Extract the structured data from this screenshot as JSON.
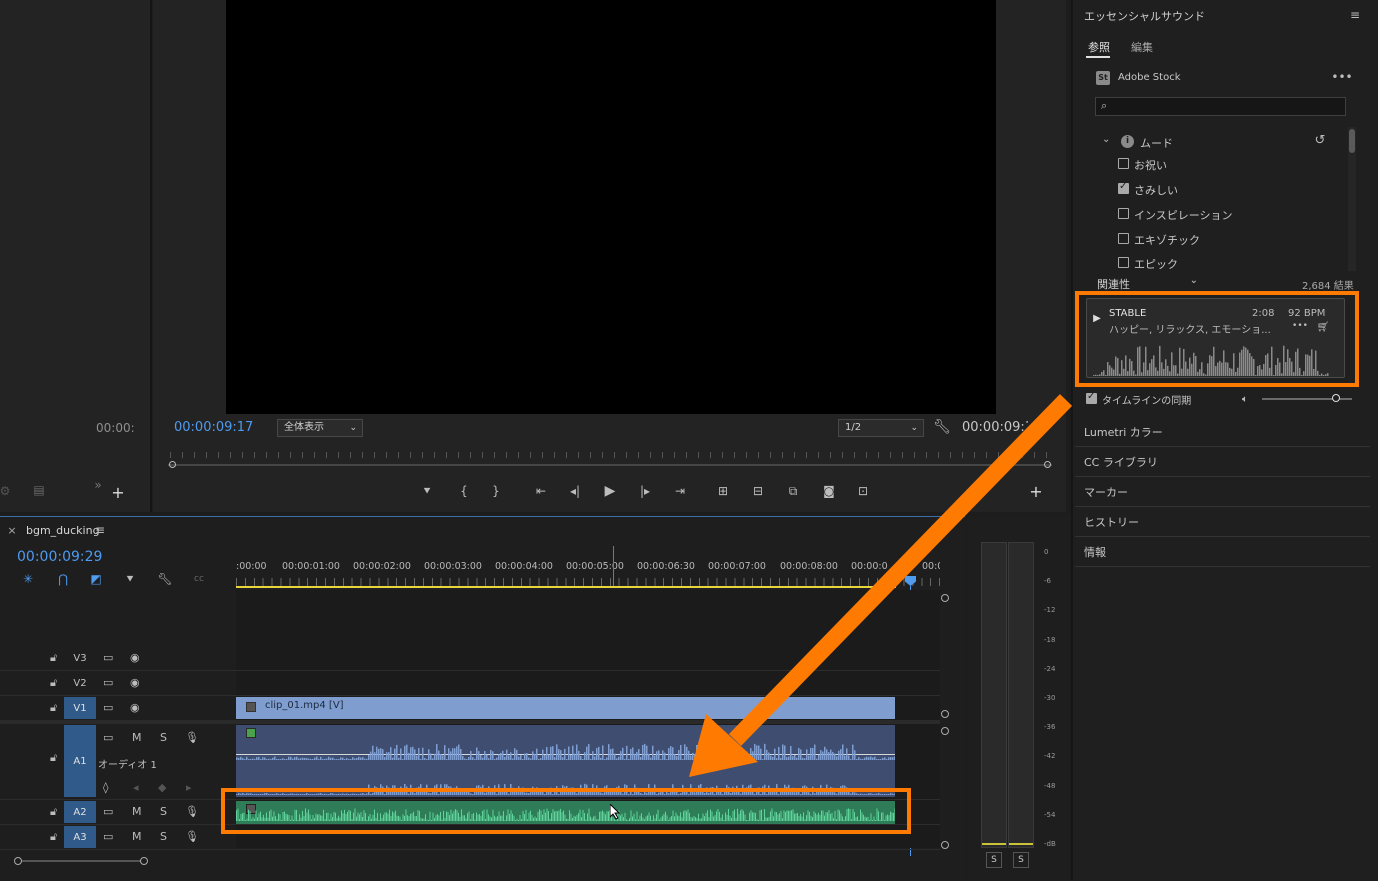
{
  "source_monitor": {
    "timecode": "00:00:"
  },
  "program_monitor": {
    "timecode": "00:00:09:17",
    "zoom_select": "全体表示",
    "resolution_select": "1/2",
    "duration": "00:00:09:1"
  },
  "essential_sound": {
    "title": "エッセンシャルサウンド",
    "tabs": [
      "参照",
      "編集"
    ],
    "active_tab": "参照",
    "source_label": "Adobe Stock",
    "search_placeholder": "",
    "filter_group": "ムード",
    "filters": [
      {
        "label": "お祝い",
        "checked": false
      },
      {
        "label": "さみしい",
        "checked": true
      },
      {
        "label": "インスピレーション",
        "checked": false
      },
      {
        "label": "エキゾチック",
        "checked": false
      },
      {
        "label": "エピック",
        "checked": false
      }
    ],
    "sort_select": "関連性",
    "results_count": "2,684 結果",
    "track": {
      "title": "STABLE",
      "duration": "2:08",
      "bpm": "92 BPM",
      "tags": "ハッピー, リラックス, エモーショ..."
    },
    "sync_label": "タイムラインの同期",
    "sync_checked": true,
    "volume_level": 0.82
  },
  "collapsed_panels": [
    "Lumetri カラー",
    "CC ライブラリ",
    "マーカー",
    "ヒストリー",
    "情報"
  ],
  "timeline": {
    "sequence_name": "bgm_ducking",
    "timecode": "00:00:09:29",
    "ruler_labels": [
      ":00:00",
      "00:00:01:00",
      "00:00:02:00",
      "00:00:03:00",
      "00:00:04:00",
      "00:00:05:00",
      "00:00:06:30",
      "00:00:07:00",
      "00:00:08:00",
      "00:00:0",
      "00:0"
    ],
    "video_tracks": [
      "V3",
      "V2",
      "V1"
    ],
    "audio_tracks": [
      "A1",
      "A2",
      "A3"
    ],
    "audio_track_name": "オーディオ 1",
    "mute_label": "M",
    "solo_label": "S",
    "video_clip": "clip_01.mp4 [V]"
  },
  "meters": {
    "scale": [
      "0",
      "-6",
      "-12",
      "-18",
      "-24",
      "-30",
      "-36",
      "-42",
      "-48",
      "-54",
      "-dB"
    ],
    "solo_buttons": [
      "S",
      "S"
    ]
  },
  "colors": {
    "accent_blue": "#4e9bf0",
    "highlight_orange": "#ff7a00",
    "audio_green": "#5fd39a",
    "video_clip": "#7f9ecf"
  }
}
